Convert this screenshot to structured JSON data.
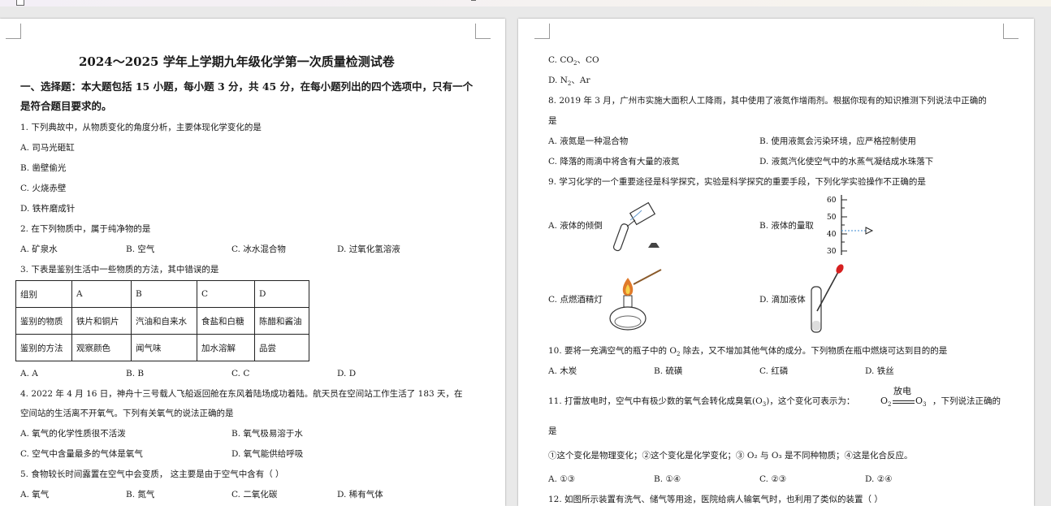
{
  "left_page": {
    "title": "2024～2025 学年上学期九年级化学第一次质量检测试卷",
    "section_line1": "一、选择题：本大题包括 15 小题，每小题 3 分，共 45 分，在每小题列出的四个选项中，只有一个",
    "section_line2": "是符合题目要求的。",
    "q1": "1. 下列典故中，从物质变化的角度分析，主要体现化学变化的是",
    "q1_a": "A. 司马光砸缸",
    "q1_b": "B. 凿壁偷光",
    "q1_c": "C. 火烧赤壁",
    "q1_d": "D. 铁杵磨成针",
    "q2": "2. 在下列物质中，属于纯净物的是",
    "q2_a": "A. 矿泉水",
    "q2_b": "B. 空气",
    "q2_c": "C. 冰水混合物",
    "q2_d": "D. 过氧化氢溶液",
    "q3": "3. 下表是鉴别生活中一些物质的方法，其中错误的是",
    "table": {
      "headers": [
        "组别",
        "A",
        "B",
        "C",
        "D"
      ],
      "rows": [
        [
          "鉴别的物质",
          "铁片和铜片",
          "汽油和自来水",
          "食盐和白糖",
          "陈醋和酱油"
        ],
        [
          "鉴别的方法",
          "观察颜色",
          "闻气味",
          "加水溶解",
          "品尝"
        ]
      ]
    },
    "q3_a": "A. A",
    "q3_b": "B. B",
    "q3_c": "C. C",
    "q3_d": "D. D",
    "q4_line1": "4. 2022 年 4 月 16 日，神舟十三号载人飞船返回舱在东风着陆场成功着陆。航天员在空间站工作生活了 183 天，在",
    "q4_line2": "空间站的生活离不开氧气。下列有关氧气的说法正确的是",
    "q4_a": "A. 氧气的化学性质很不活泼",
    "q4_b": "B. 氧气极易溶于水",
    "q4_c": "C. 空气中含量最多的气体是氧气",
    "q4_d": "D. 氧气能供给呼吸",
    "q5": "5. 食物较长时间露置在空气中会变质， 这主要是由于空气中含有（    ）",
    "q5_a": "A. 氧气",
    "q5_b": "B. 氮气",
    "q5_c": "C. 二氧化碳",
    "q5_d": "D. 稀有气体"
  },
  "right_page": {
    "q7_c_pre": "C. CO",
    "q7_c_sub": "2",
    "q7_c_post": "、CO",
    "q7_d_pre": "D. N",
    "q7_d_sub": "2",
    "q7_d_post": "、Ar",
    "q8_line1": "8. 2019 年 3 月，广州市实施大面积人工降雨，其中使用了液氮作增雨剂。根据你现有的知识推测下列说法中正确的",
    "q8_line2": "是",
    "q8_a": "A. 液氮是一种混合物",
    "q8_b": "B. 使用液氮会污染环境，应严格控制使用",
    "q8_c": "C. 降落的雨滴中将含有大量的液氮",
    "q8_d": "D. 液氮汽化使空气中的水蒸气凝结成水珠落下",
    "q9": "9. 学习化学的一个重要途径是科学探究，实验是科学探究的重要手段，下列化学实验操作不正确的是",
    "q9_a": "A. 液体的倾倒",
    "q9_b": "B. 液体的量取",
    "q9_c": "C. 点燃酒精灯",
    "q9_d": "D. 滴加液体",
    "cylinder_ticks": [
      "60",
      "50",
      "40",
      "30"
    ],
    "q10_pre": "10. 要将一充满空气的瓶子中的 O",
    "q10_sub": "2",
    "q10_post": " 除去，又不增加其他气体的成分。下列物质在瓶中燃烧可达到目的的是",
    "q10_a": "A. 木炭",
    "q10_b": "B. 硫磺",
    "q10_c": "C. 红磷",
    "q10_d": "D. 铁丝",
    "q11_pre": "11. 打雷放电时，空气中有极少数的氧气会转化成臭氧(O",
    "q11_sub": "3",
    "q11_mid": ")，这个变化可表示为：",
    "q11_eq_left": "O",
    "q11_eq_left_sub": "2",
    "q11_eq_cond": "放电",
    "q11_eq_right": "O",
    "q11_eq_right_sub": "3",
    "q11_post": "，下列说法正确的",
    "q11_line2": "是",
    "q11_statements": "①这个变化是物理变化；②这个变化是化学变化；③ O₂ 与 O₃ 是不同种物质；④这是化合反应。",
    "q11_a": "A. ①③",
    "q11_b": "B. ①④",
    "q11_c": "C. ②③",
    "q11_d": "D. ②④",
    "q12_partial": "12. 如图所示装置有洗气、储气等用途，医院给病人输氧气时，也利用了类似的装置（    ）"
  }
}
